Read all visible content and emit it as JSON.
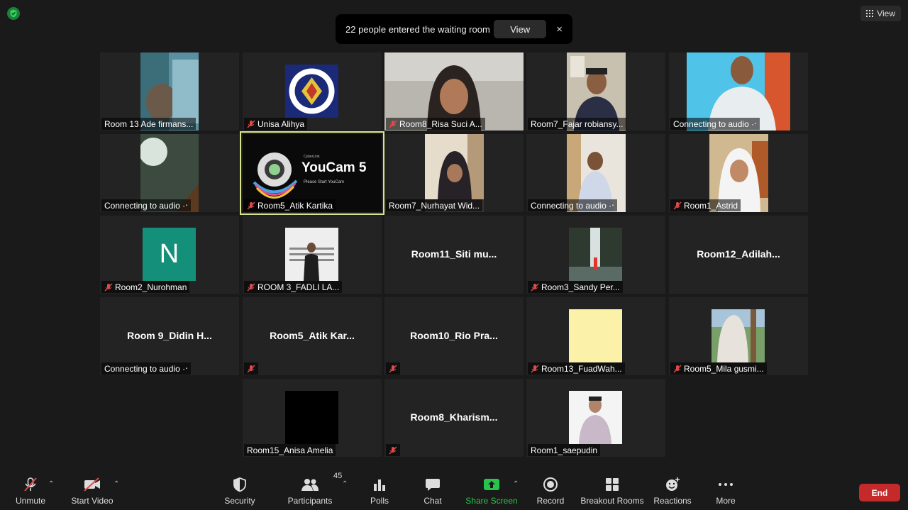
{
  "top": {
    "view_label": "View",
    "notice_text": "22 people entered the waiting room",
    "notice_button": "View",
    "notice_close": "×"
  },
  "tiles": {
    "r1c1": {
      "name": "Room 13 Ade firmans..."
    },
    "r1c2": {
      "name": "Unisa Alihya"
    },
    "r1c3": {
      "name": "Room8_Risa Suci A..."
    },
    "r1c4": {
      "name": "Room7_Fajar robiansy..."
    },
    "r1c5": {
      "name": "Connecting to audio ·‧"
    },
    "r2c1": {
      "name": "Connecting to audio ·‧"
    },
    "r2c2": {
      "name": "Room5_Atik Kartika",
      "logo_text": "YouCam 5",
      "logo_brand": "CyberLink",
      "logo_sub": "Please Start YouCam"
    },
    "r2c3": {
      "name": "Room7_Nurhayat Wid..."
    },
    "r2c4": {
      "name": "Connecting to audio ·‧"
    },
    "r2c5": {
      "name": "Room1_Astrid"
    },
    "r3c1": {
      "name": "Room2_Nurohman",
      "avatar_letter": "N"
    },
    "r3c2": {
      "name": "ROOM 3_FADLI LA..."
    },
    "r3c3": {
      "big": "Room11_Siti  mu..."
    },
    "r3c4": {
      "name": "Room3_Sandy Per..."
    },
    "r3c5": {
      "big": "Room12_Adilah..."
    },
    "r4c1": {
      "big": "Room  9_Didin  H...",
      "name": "Connecting to audio ·‧"
    },
    "r4c2": {
      "big": "Room5_Atik  Kar..."
    },
    "r4c3": {
      "big": "Room10_Rio  Pra..."
    },
    "r4c4": {
      "name": "Room13_FuadWah..."
    },
    "r4c5": {
      "name": "Room5_Mila gusmi..."
    },
    "r5c2": {
      "name": "Room15_Anisa Amelia"
    },
    "r5c3": {
      "big": "Room8_Kharism..."
    },
    "r5c4": {
      "name": "Room1_saepudin"
    }
  },
  "toolbar": {
    "unmute": "Unmute",
    "start_video": "Start Video",
    "security": "Security",
    "participants": "Participants",
    "participants_count": "45",
    "polls": "Polls",
    "chat": "Chat",
    "share_screen": "Share Screen",
    "record": "Record",
    "breakout_rooms": "Breakout Rooms",
    "reactions": "Reactions",
    "more": "More",
    "end": "End"
  },
  "colors": {
    "share_green": "#27c44c",
    "end_red": "#c42a2a",
    "active_border": "#d9e38a",
    "avatar_teal": "#138f7a",
    "mute_red": "#e04a4a"
  }
}
